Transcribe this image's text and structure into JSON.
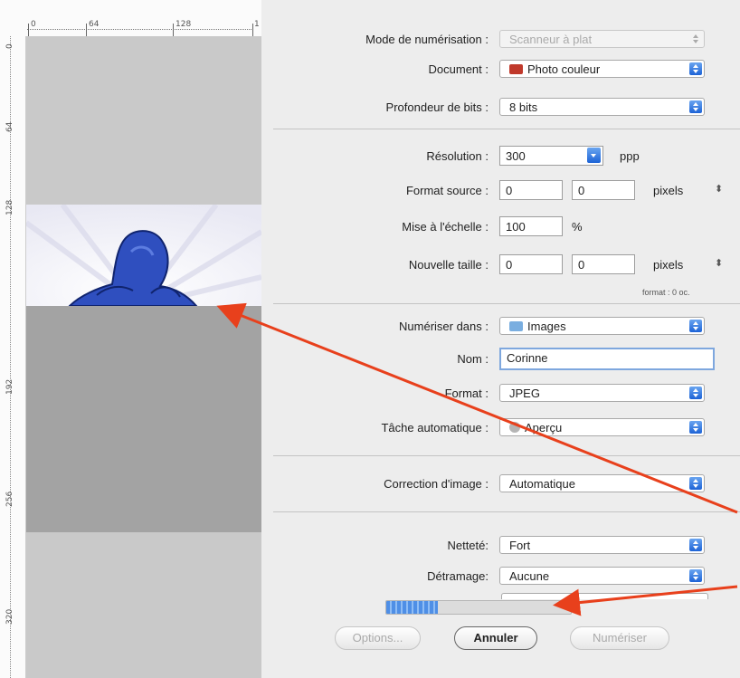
{
  "ruler": {
    "top_labels": [
      "0",
      "64",
      "128",
      "1"
    ],
    "left_labels": [
      "0",
      "64",
      "128",
      "192",
      "256",
      "320"
    ]
  },
  "settings": {
    "mode": {
      "label": "Mode de numérisation :",
      "value": "Scanneur à plat"
    },
    "document": {
      "label": "Document :",
      "value": "Photo couleur",
      "icon": "photo-icon"
    },
    "bits": {
      "label": "Profondeur de bits :",
      "value": "8 bits"
    },
    "resolution": {
      "label": "Résolution :",
      "value": "300",
      "unit": "ppp"
    },
    "source_format": {
      "label": "Format  source :",
      "width": "0",
      "height": "0",
      "unit": "pixels"
    },
    "scale": {
      "label": "Mise à l'échelle :",
      "value": "100",
      "unit": "%"
    },
    "new_size": {
      "label": "Nouvelle taille :",
      "width": "0",
      "height": "0",
      "unit": "pixels",
      "note": "format : 0 oc."
    },
    "scan_to": {
      "label": "Numériser dans :",
      "value": "Images",
      "icon": "folder-icon"
    },
    "name": {
      "label": "Nom :",
      "value": "Corinne"
    },
    "format": {
      "label": "Format :",
      "value": "JPEG"
    },
    "auto_task": {
      "label": "Tâche automatique :",
      "value": "Aperçu",
      "icon": "app-icon"
    },
    "correction": {
      "label": "Correction d'image :",
      "value": "Automatique"
    },
    "sharpness": {
      "label": "Netteté:",
      "value": "Fort"
    },
    "descreen": {
      "label": "Détramage:",
      "value": "Aucune"
    }
  },
  "progress": {
    "fraction": 0.28
  },
  "buttons": {
    "options": "Options...",
    "cancel": "Annuler",
    "scan": "Numériser"
  },
  "colors": {
    "accent_blue": "#1d63d6",
    "arrow_red": "#e8401c",
    "figure_blue": "#2f4fbf"
  }
}
